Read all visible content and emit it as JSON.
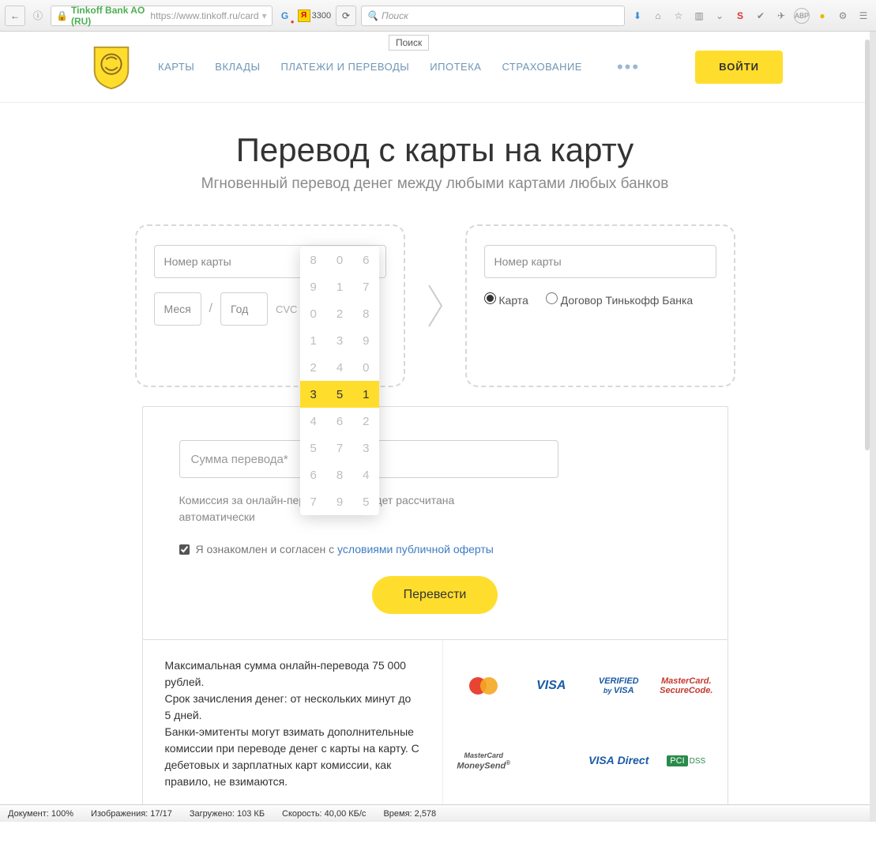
{
  "browser": {
    "site_label": "Tinkoff Bank AO (RU)",
    "url": "https://www.tinkoff.ru/card",
    "ya_badge": "3300",
    "search_placeholder": "Поиск",
    "search_tooltip": "Поиск"
  },
  "nav": {
    "items": [
      "КАРТЫ",
      "ВКЛАДЫ",
      "ПЛАТЕЖИ И ПЕРЕВОДЫ",
      "ИПОТЕКА",
      "СТРАХОВАНИЕ"
    ],
    "login": "ВОЙТИ"
  },
  "page": {
    "title": "Перевод с карты на карту",
    "subtitle": "Мгновенный перевод денег между любыми картами любых банков"
  },
  "from_card": {
    "number_ph": "Номер карты",
    "month_ph": "Месяц",
    "year_ph": "Год",
    "cvc_label": "CVC"
  },
  "to_card": {
    "number_ph": "Номер карты",
    "radio_card": "Карта",
    "radio_contract": "Договор Тинькофф Банка"
  },
  "spinner": {
    "rows": [
      [
        "8",
        "0",
        "6"
      ],
      [
        "9",
        "1",
        "7"
      ],
      [
        "0",
        "2",
        "8"
      ],
      [
        "1",
        "3",
        "9"
      ],
      [
        "2",
        "4",
        "0"
      ],
      [
        "3",
        "5",
        "1"
      ],
      [
        "4",
        "6",
        "2"
      ],
      [
        "5",
        "7",
        "3"
      ],
      [
        "6",
        "8",
        "4"
      ],
      [
        "7",
        "9",
        "5"
      ]
    ],
    "highlight_index": 5
  },
  "form": {
    "amount_ph": "Сумма перевода*",
    "commission_note": "Комиссия за онлайн-перевод денег будет рассчитана автоматически",
    "agree_prefix": "Я ознакомлен и согласен с ",
    "agree_link": "условиями публичной оферты",
    "submit": "Перевести"
  },
  "footer_text": "Максимальная сумма онлайн-перевода 75 000 рублей.\nСрок зачисления денег: от нескольких минут до 5 дней.\nБанки-эмитенты могут взимать дополнительные комиссии при переводе денег с карты на карту. С дебетовых и зарплатных карт комиссии, как правило, не взимаются.",
  "paylogos": {
    "visa": "VISA",
    "vbv": "VERIFIED by VISA",
    "msc": "MasterCard. SecureCode.",
    "msend": "MasterCard MoneySend",
    "vdirect": "VISA Direct",
    "pci": "PCI",
    "dss": "DSS"
  },
  "status": {
    "doc": "Документ: 100%",
    "img": "Изображения: 17/17",
    "loaded": "Загружено: 103 КБ",
    "speed": "Скорость: 40,00 КБ/c",
    "time": "Время: 2,578"
  }
}
